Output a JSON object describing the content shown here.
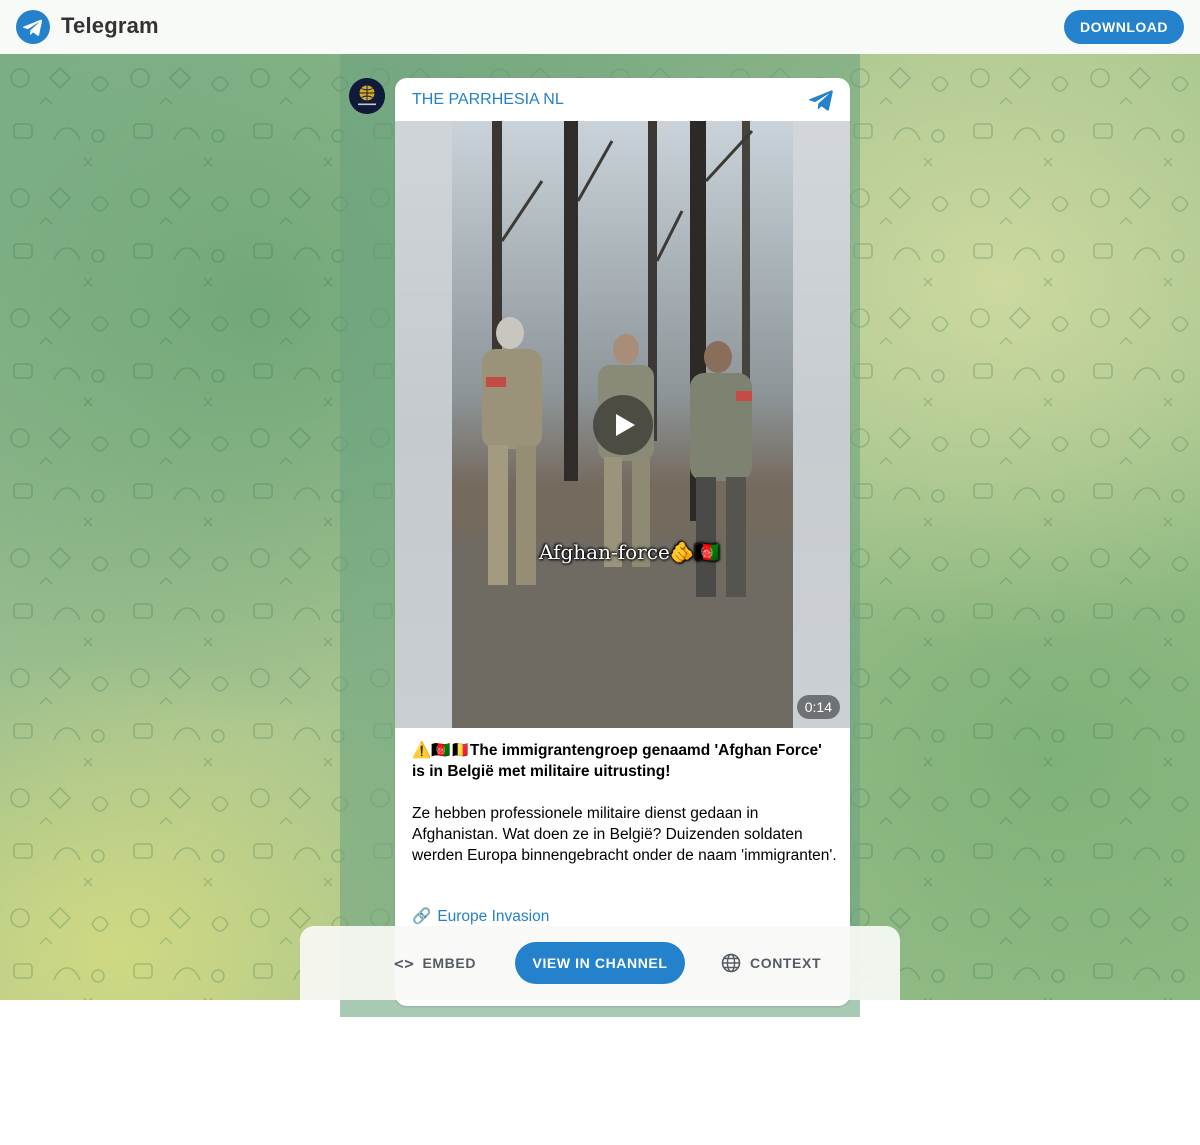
{
  "header": {
    "app_name": "Telegram",
    "download_label": "DOWNLOAD",
    "accent_color": "#2481cc"
  },
  "post": {
    "channel_name": "THE PARRHESIA NL",
    "video": {
      "overlay_caption": "Afghan-force🫵🇦🇫",
      "duration": "0:14"
    },
    "headline": "⚠️🇦🇫🇧🇪The immigrantengroep genaamd 'Afghan Force' is in België met militaire uitrusting!",
    "body": "Ze hebben professionele militaire dienst gedaan in Afghanistan. Wat doen ze in België? Duizenden soldaten werden Europa binnengebracht onder de naam 'immigranten'.",
    "link_icon": "🔗",
    "link_label": "Europe Invasion"
  },
  "actions": {
    "embed_label": "EMBED",
    "view_label": "VIEW IN CHANNEL",
    "context_label": "CONTEXT"
  }
}
